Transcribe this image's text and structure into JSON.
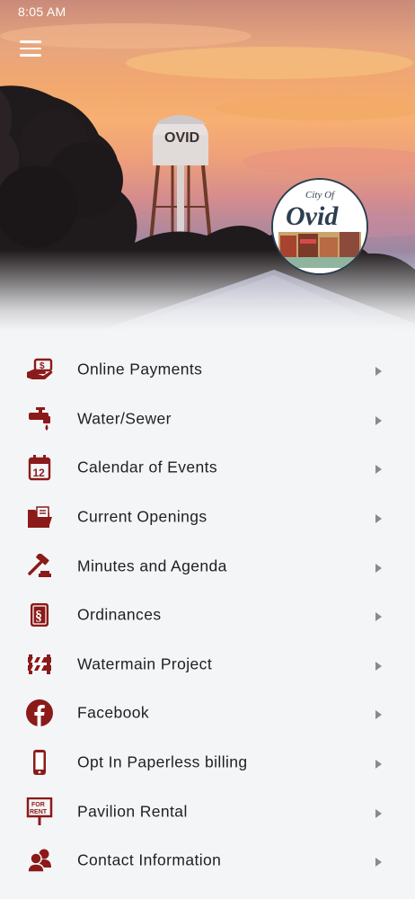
{
  "status_bar": {
    "time": "8:05 AM"
  },
  "header": {
    "menu_icon": "hamburger-menu-icon",
    "logo": {
      "line1": "City Of",
      "line2": "Ovid"
    }
  },
  "theme": {
    "accent": "#8b1a1a",
    "background": "#f4f5f7",
    "text": "#1f1f1f",
    "chevron": "#8a8a8a"
  },
  "menu": {
    "items": [
      {
        "label": "Online Payments",
        "icon": "payment-hand-icon"
      },
      {
        "label": "Water/Sewer",
        "icon": "faucet-icon"
      },
      {
        "label": "Calendar of Events",
        "icon": "calendar-icon"
      },
      {
        "label": "Current Openings",
        "icon": "folder-icon"
      },
      {
        "label": "Minutes and Agenda",
        "icon": "gavel-icon"
      },
      {
        "label": "Ordinances",
        "icon": "section-book-icon"
      },
      {
        "label": "Watermain Project",
        "icon": "construction-barrier-icon"
      },
      {
        "label": "Facebook",
        "icon": "facebook-icon"
      },
      {
        "label": "Opt In Paperless billing",
        "icon": "mobile-phone-icon"
      },
      {
        "label": "Pavilion Rental",
        "icon": "for-rent-sign-icon"
      },
      {
        "label": "Contact Information",
        "icon": "contacts-icon"
      }
    ]
  }
}
